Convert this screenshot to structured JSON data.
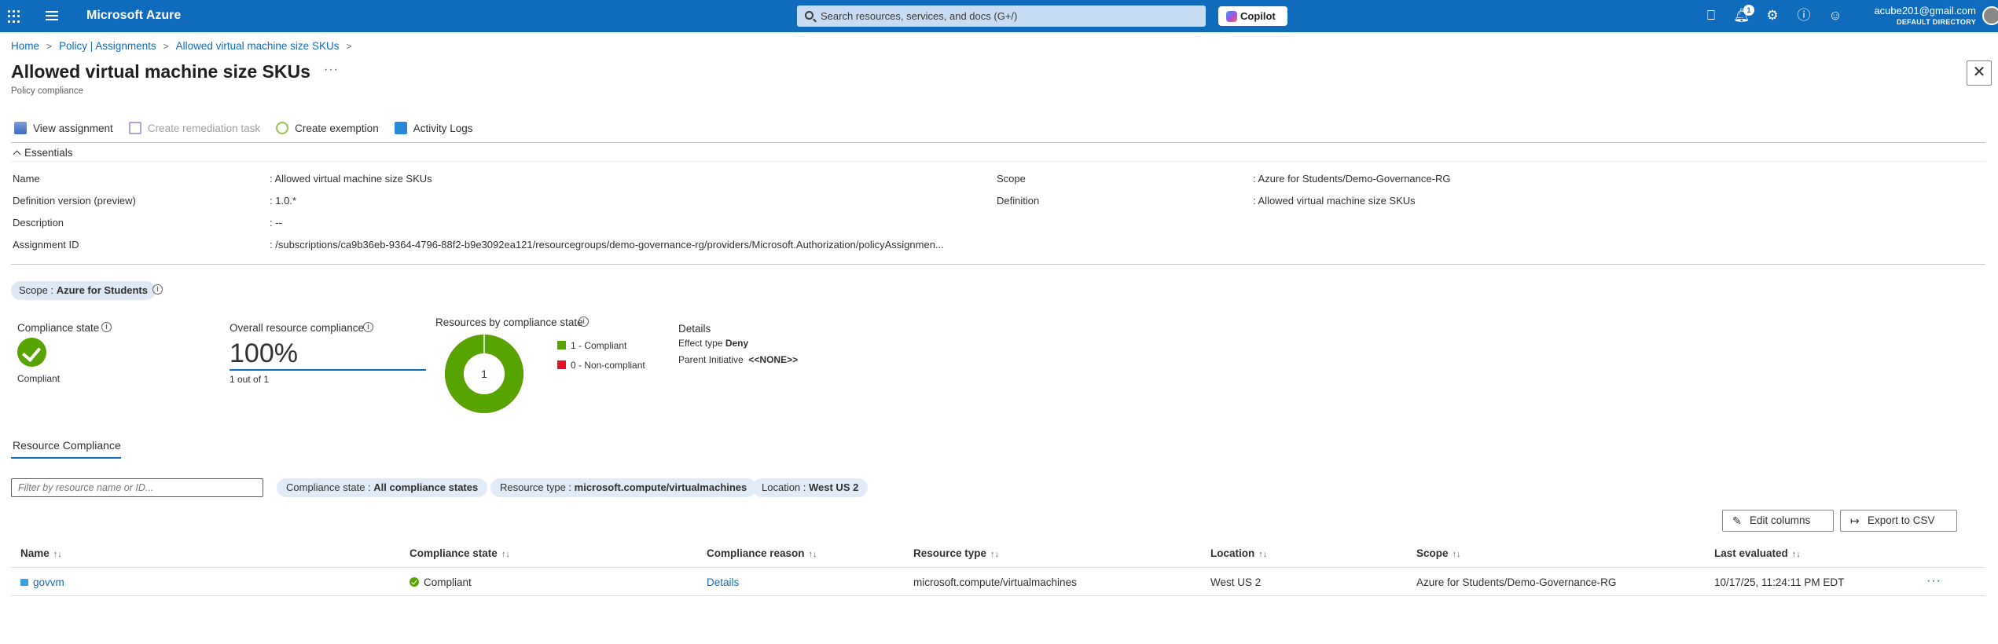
{
  "topbar": {
    "brand": "Microsoft Azure",
    "search_placeholder": "Search resources, services, and docs (G+/)",
    "copilot_label": "Copilot",
    "notification_count": "1",
    "account_email": "acube201@gmail.com",
    "account_directory": "DEFAULT DIRECTORY"
  },
  "breadcrumb": [
    "Home",
    "Policy | Assignments",
    "Allowed virtual machine size SKUs"
  ],
  "page": {
    "title": "Allowed virtual machine size SKUs",
    "subtitle": "Policy compliance",
    "more": "···"
  },
  "commands": {
    "view_assignment": "View assignment",
    "create_remediation": "Create remediation task",
    "create_exemption": "Create exemption",
    "activity_logs": "Activity Logs"
  },
  "essentials": {
    "toggle_label": "Essentials",
    "name_label": "Name",
    "name_value": ": Allowed virtual machine size SKUs",
    "defver_label": "Definition version (preview)",
    "defver_value": ": 1.0.*",
    "desc_label": "Description",
    "desc_value": ": --",
    "assign_label": "Assignment ID",
    "assign_value": ": /subscriptions/ca9b36eb-9364-4796-88f2-b9e3092ea121/resourcegroups/demo-governance-rg/providers/Microsoft.Authorization/policyAssignmen...",
    "scope_label": "Scope",
    "scope_value": ": Azure for Students/Demo-Governance-RG",
    "definition_label": "Definition",
    "definition_value": ": Allowed virtual machine size SKUs"
  },
  "scope_pill": {
    "key": "Scope : ",
    "value": "Azure for Students"
  },
  "summary": {
    "compliance_state_label": "Compliance state",
    "compliance_state_value": "Compliant",
    "overall_label": "Overall resource compliance",
    "overall_pct": "100%",
    "overall_sub": "1 out of 1",
    "by_state_label": "Resources by compliance state",
    "donut_center": "1",
    "legend_compliant": "1 - Compliant",
    "legend_noncompliant": "0 - Non-compliant",
    "compliant_count": 1,
    "noncompliant_count": 0,
    "details_label": "Details",
    "effect_label": "Effect type",
    "effect_value": "Deny",
    "parent_label": "Parent Initiative",
    "parent_value": "<<NONE>>",
    "color_compliant": "#57a300",
    "color_noncompliant": "#e81123"
  },
  "tabs": {
    "resource_compliance": "Resource Compliance"
  },
  "filters": {
    "input_placeholder": "Filter by resource name or ID...",
    "pill1_key": "Compliance state : ",
    "pill1_value": "All compliance states",
    "pill2_key": "Resource type : ",
    "pill2_value": "microsoft.compute/virtualmachines",
    "pill3_key": "Location : ",
    "pill3_value": "West US 2"
  },
  "buttons": {
    "edit_columns": "Edit columns",
    "export_csv": "Export to CSV"
  },
  "table": {
    "headers": [
      "Name",
      "Compliance state",
      "Compliance reason",
      "Resource type",
      "Location",
      "Scope",
      "Last evaluated"
    ],
    "sort_glyph": "↑↓",
    "rows": [
      {
        "name": "govvm",
        "state": "Compliant",
        "reason": "Details",
        "type": "microsoft.compute/virtualmachines",
        "location": "West US 2",
        "scope": "Azure for Students/Demo-Governance-RG",
        "last_evaluated": "10/17/25, 11:24:11 PM EDT"
      }
    ],
    "row_more": "···"
  }
}
